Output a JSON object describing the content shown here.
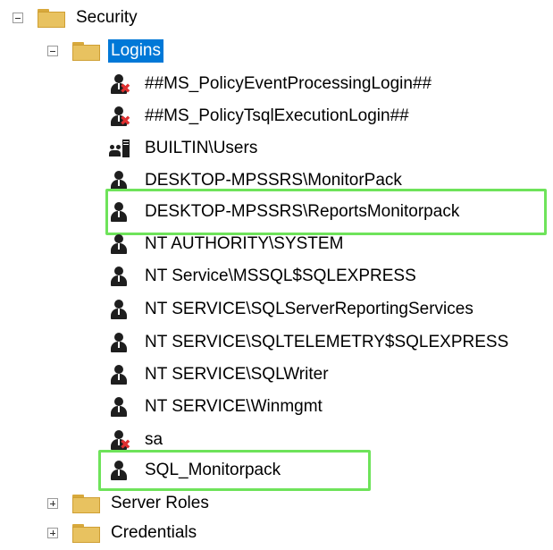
{
  "tree": {
    "security": {
      "label": "Security",
      "expanded": true
    },
    "logins": {
      "label": "Logins",
      "expanded": true,
      "selected": true
    },
    "login_items": [
      {
        "label": "##MS_PolicyEventProcessingLogin##",
        "icon": "user-disabled-icon"
      },
      {
        "label": "##MS_PolicyTsqlExecutionLogin##",
        "icon": "user-disabled-icon"
      },
      {
        "label": "BUILTIN\\Users",
        "icon": "group-icon"
      },
      {
        "label": "DESKTOP-MPSSRS\\MonitorPack",
        "icon": "user-icon"
      },
      {
        "label": "DESKTOP-MPSSRS\\ReportsMonitorpack",
        "icon": "user-icon",
        "highlighted": true
      },
      {
        "label": "NT AUTHORITY\\SYSTEM",
        "icon": "user-icon"
      },
      {
        "label": "NT Service\\MSSQL$SQLEXPRESS",
        "icon": "user-icon"
      },
      {
        "label": "NT SERVICE\\SQLServerReportingServices",
        "icon": "user-icon"
      },
      {
        "label": "NT SERVICE\\SQLTELEMETRY$SQLEXPRESS",
        "icon": "user-icon"
      },
      {
        "label": "NT SERVICE\\SQLWriter",
        "icon": "user-icon"
      },
      {
        "label": "NT SERVICE\\Winmgmt",
        "icon": "user-icon"
      },
      {
        "label": "sa",
        "icon": "user-disabled-icon"
      },
      {
        "label": "SQL_Monitorpack",
        "icon": "user-icon",
        "highlighted": true
      }
    ],
    "server_roles": {
      "label": "Server Roles",
      "expanded": false
    },
    "credentials": {
      "label": "Credentials",
      "expanded": false
    }
  },
  "colors": {
    "selection": "#0078d7",
    "highlight_border": "#6ee35a",
    "folder": "#e8c260",
    "disabled_mark": "#e03030"
  }
}
